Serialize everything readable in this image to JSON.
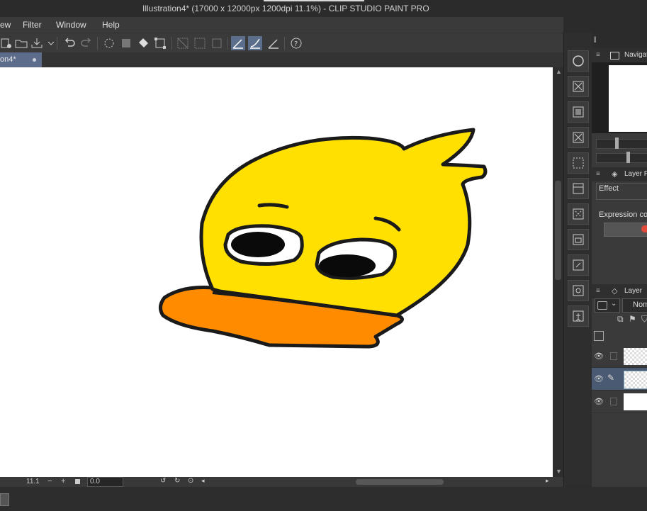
{
  "window": {
    "title": "Illustration4* (17000 x 12000px 1200dpi 11.1%)  - CLIP STUDIO PAINT PRO"
  },
  "menu": {
    "items": [
      "ew",
      "Filter",
      "Window",
      "Help"
    ]
  },
  "tabs": {
    "document_tab_label": "on4*"
  },
  "status": {
    "zoom_value": "11.1",
    "rotation_value": "0.0"
  },
  "panels": {
    "navigator_title": "Navigat",
    "layer_property_title": "Layer P",
    "effect_label": "Effect",
    "expression_color_label": "Expression col",
    "layer_title": "Layer",
    "blend_mode_value": "Nom"
  },
  "colors": {
    "duck_body": "#FFE000",
    "duck_beak": "#FF8C00",
    "outline": "#1a1a1a",
    "active_tool": "#5b6e8c",
    "tab_active": "#5c6c8a"
  }
}
